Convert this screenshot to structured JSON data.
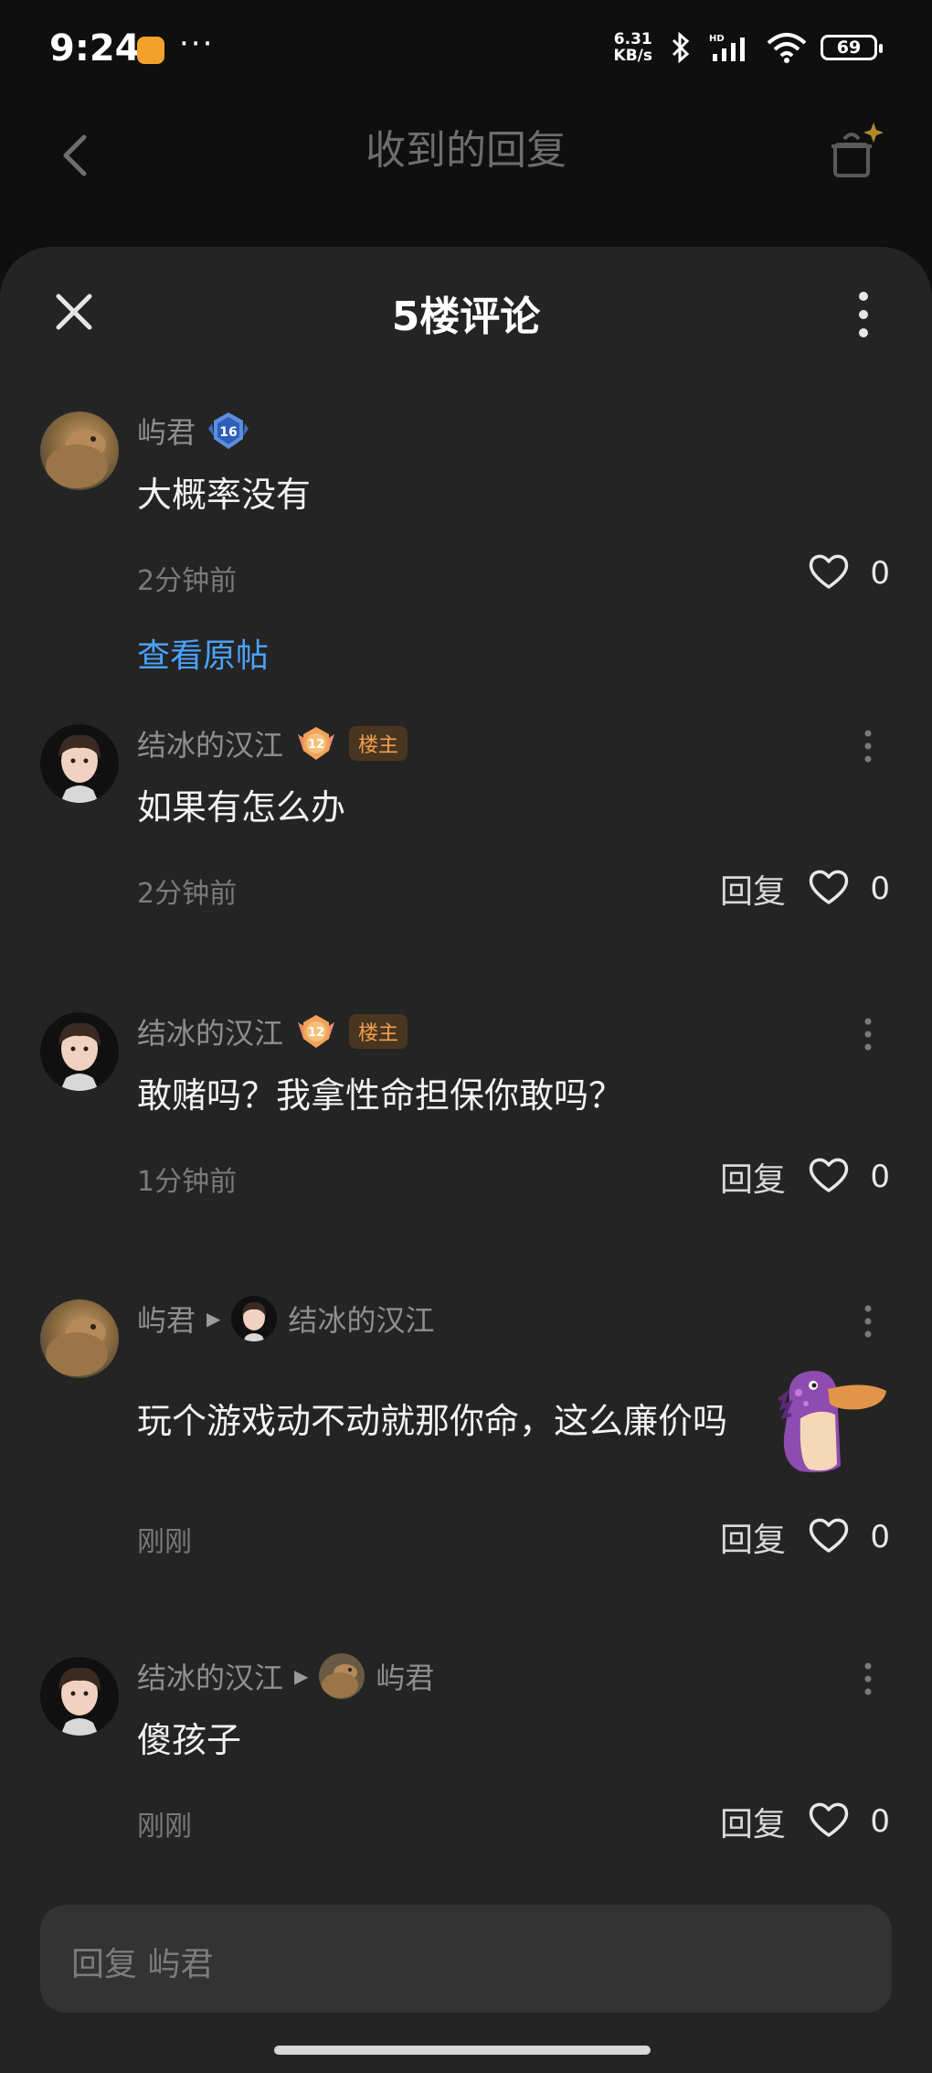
{
  "status_bar": {
    "time": "9:24",
    "network_speed_top": "6.31",
    "network_speed_bottom": "KB/s",
    "battery": "69",
    "icons": [
      "app-notification-icon",
      "bluetooth-icon",
      "hd-signal-icon",
      "wifi-icon",
      "battery-icon"
    ]
  },
  "background_header": {
    "title": "收到的回复",
    "back_icon": "chevron-left-icon",
    "right_icon": "clean-sparkle-icon"
  },
  "sheet": {
    "title": "5楼评论",
    "close_icon": "close-icon",
    "more_icon": "more-vertical-icon"
  },
  "main_comment": {
    "user": "屿君",
    "level": "16",
    "content": "大概率没有",
    "time": "2分钟前",
    "likes": "0",
    "view_post": "查看原帖"
  },
  "replies": [
    {
      "user": "结冰的汉江",
      "level": "12",
      "tag": "楼主",
      "content": "如果有怎么办",
      "time": "2分钟前",
      "reply_label": "回复",
      "likes": "0"
    },
    {
      "user": "结冰的汉江",
      "level": "12",
      "tag": "楼主",
      "content": "敢赌吗？我拿性命担保你敢吗？",
      "time": "1分钟前",
      "reply_label": "回复",
      "likes": "0"
    },
    {
      "user": "屿君",
      "reply_to": "结冰的汉江",
      "content": "玩个游戏动不动就那你命，这么廉价吗",
      "time": "刚刚",
      "reply_label": "回复",
      "likes": "0"
    },
    {
      "user": "结冰的汉江",
      "reply_to": "屿君",
      "content": "傻孩子",
      "time": "刚刚",
      "reply_label": "回复",
      "likes": "0"
    }
  ],
  "input": {
    "placeholder": "回复 屿君"
  },
  "colors": {
    "sheet_bg": "#242424",
    "link": "#4aa3ff",
    "owner_tag": "#f0a050",
    "level_blue": "#5b8fe0",
    "level_orange": "#f2a35a"
  }
}
